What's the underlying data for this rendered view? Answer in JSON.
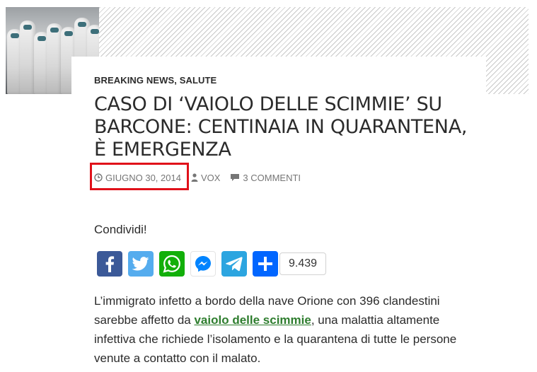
{
  "article": {
    "categories": [
      "BREAKING NEWS",
      "SALUTE"
    ],
    "category_separator": ", ",
    "title": "CASO DI ‘VAIOLO DELLE SCIMMIE’ SU BARCONE: CENTINAIA IN QUARANTENA, È EMERGENZA",
    "date": "GIUGNO 30, 2014",
    "author": "VOX",
    "comments": "3 COMMENTI",
    "body_before_link": "L’immigrato infetto a bordo della nave Orione con 396 clandestini sarebbe affetto da ",
    "body_link": "vaiolo delle scimmie",
    "body_after_link": ", una malattia altamente infettiva che richiede l’isolamento e la quarantena di tutte le persone venute a contatto con il malato."
  },
  "share": {
    "heading": "Condividi!",
    "buttons": [
      {
        "network": "facebook",
        "icon": "facebook-icon",
        "color": "#3b5998"
      },
      {
        "network": "twitter",
        "icon": "twitter-icon",
        "color": "#55acee"
      },
      {
        "network": "whatsapp",
        "icon": "whatsapp-icon",
        "color": "#12af0a"
      },
      {
        "network": "messenger",
        "icon": "messenger-icon",
        "color": "#0084ff"
      },
      {
        "network": "telegram",
        "icon": "telegram-icon",
        "color": "#2ca5e0"
      },
      {
        "network": "more",
        "icon": "plus-icon",
        "color": "#0166ff"
      }
    ],
    "count": "9.439"
  },
  "colors": {
    "highlight_box": "#e0111a",
    "link": "#2e7d2e",
    "meta_text": "#767676"
  }
}
